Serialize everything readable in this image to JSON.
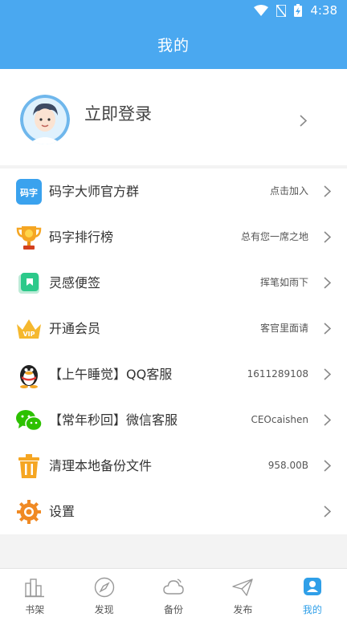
{
  "status": {
    "time": "4:38"
  },
  "header": {
    "title": "我的"
  },
  "profile": {
    "login_label": "立即登录"
  },
  "menu": [
    {
      "icon": "qq-group-app-icon",
      "label": "码字大师官方群",
      "value": "点击加入"
    },
    {
      "icon": "trophy-icon",
      "label": "码字排行榜",
      "value": "总有您一席之地"
    },
    {
      "icon": "note-icon",
      "label": "灵感便签",
      "value": "挥笔如雨下"
    },
    {
      "icon": "vip-crown-icon",
      "label": "开通会员",
      "value": "客官里面请"
    },
    {
      "icon": "qq-penguin-icon",
      "label": "【上午睡觉】QQ客服",
      "value": "1611289108"
    },
    {
      "icon": "wechat-icon",
      "label": "【常年秒回】微信客服",
      "value": "CEOcaishen"
    },
    {
      "icon": "trash-icon",
      "label": "清理本地备份文件",
      "value": "958.00B"
    },
    {
      "icon": "gear-icon",
      "label": "设置",
      "value": ""
    }
  ],
  "tabs": [
    {
      "icon": "bookshelf-icon",
      "label": "书架"
    },
    {
      "icon": "compass-icon",
      "label": "发现"
    },
    {
      "icon": "cloud-icon",
      "label": "备份"
    },
    {
      "icon": "paper-plane-icon",
      "label": "发布"
    },
    {
      "icon": "user-icon",
      "label": "我的",
      "active": true
    }
  ],
  "colors": {
    "header": "#4aa8f0",
    "active_tab": "#2f9fe8"
  }
}
